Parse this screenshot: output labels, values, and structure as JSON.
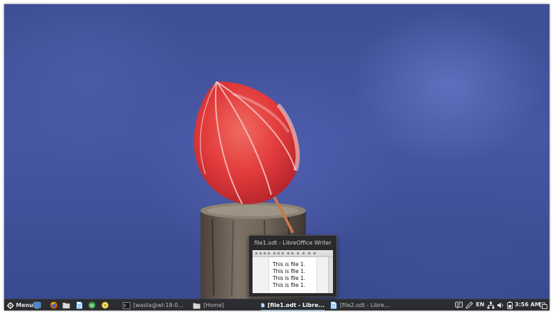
{
  "taskbar": {
    "menu_label": "Menu",
    "launchers": [
      {
        "name": "show-desktop-icon"
      },
      {
        "name": "firefox-icon"
      },
      {
        "name": "files-icon"
      },
      {
        "name": "writer-icon"
      },
      {
        "name": "wasta-icon"
      },
      {
        "name": "paratext-icon"
      }
    ],
    "tasks": [
      {
        "label": "[wasta@wl-18-0...",
        "icon": "terminal-icon",
        "active": false
      },
      {
        "label": "[Home]",
        "icon": "folder-icon",
        "active": false
      },
      {
        "label": "[file1.odt - Libre...",
        "icon": "document-icon",
        "active": true
      },
      {
        "label": "[file2.odt - Libre...",
        "icon": "document-icon",
        "active": false
      }
    ],
    "tray": {
      "language": "EN",
      "clock": "3:56 AM"
    }
  },
  "preview": {
    "title": "file1.odt - LibreOffice Writer",
    "lines": [
      "This is file 1.",
      "This is file 1.",
      "This is file 1.",
      "This is file 1."
    ]
  },
  "colors": {
    "taskbar_bg": "#2b2d30",
    "active_task_underline": "#6a9fd8",
    "wallpaper_blue": "#4656a3",
    "leaf_red": "#e23b3b"
  }
}
